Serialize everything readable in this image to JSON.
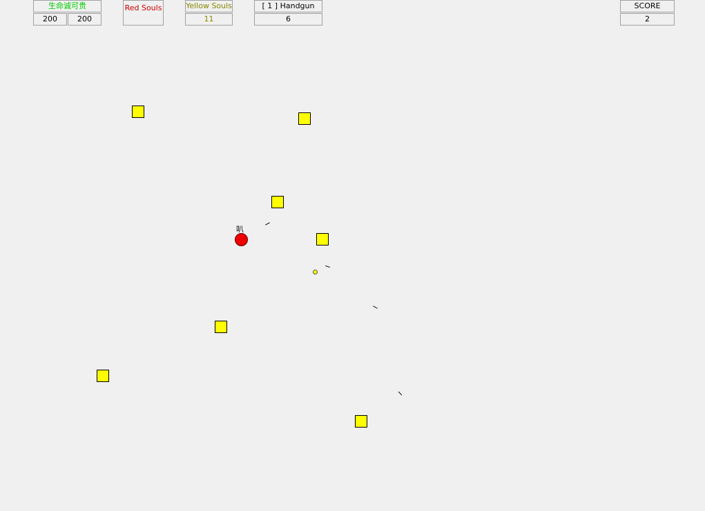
{
  "hud": {
    "health": {
      "label": "生命诚可贵",
      "current": "200",
      "max": "200",
      "color": "#00cc00"
    },
    "red_souls": {
      "label": "Red Souls",
      "value": "",
      "color": "#cc0000"
    },
    "yellow_souls": {
      "label": "Yellow Souls",
      "value": "11",
      "color": "#888800"
    },
    "weapon": {
      "label": "[ 1 ]  Handgun",
      "ammo": "6"
    },
    "score": {
      "label": "SCORE",
      "value": "2"
    }
  },
  "player": {
    "tag": "叭",
    "color": "#ee0000"
  },
  "enemy_color": "#ffff00"
}
